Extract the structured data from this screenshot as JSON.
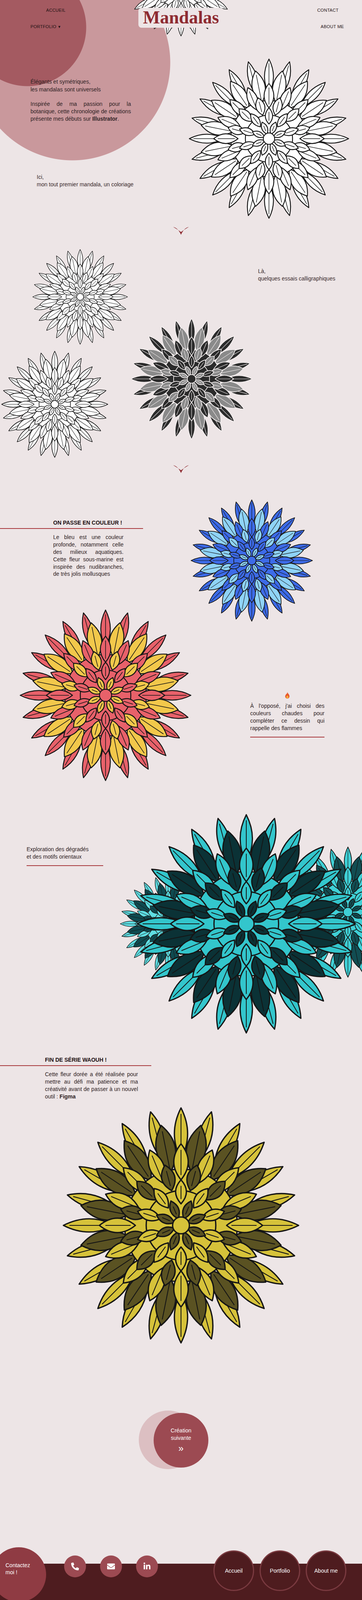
{
  "title": "Mandalas",
  "nav_left": [
    {
      "label": "ACCUEIL"
    },
    {
      "label": "PORTFOLIO",
      "caret": "▾"
    }
  ],
  "nav_right": [
    {
      "label": "CONTACT"
    },
    {
      "label": "ABOUT ME"
    }
  ],
  "intro": {
    "lead": [
      "Élégants et symétriques,",
      "les mandalas sont universels"
    ],
    "body": "Inspirée de ma passion pour la botanique, cette chronologie de créations présente mes débuts sur ",
    "strong": "Illustrator",
    "tail": "."
  },
  "first": {
    "caption": [
      "Ici,",
      "mon tout premier mandala, un coloriage"
    ],
    "art": {
      "colors": [
        "#ffffff"
      ]
    }
  },
  "calligraphy": {
    "caption": [
      "Là,",
      "quelques essais calligraphiques"
    ],
    "art": [
      {
        "colors": [
          "#ffffff"
        ]
      },
      {
        "colors": [
          "#2b2b2b"
        ]
      },
      {
        "colors": [
          "#ffffff"
        ]
      }
    ]
  },
  "blue": {
    "heading": "ON PASSE EN COULEUR !",
    "text": "Le bleu est une couleur profonde, notamment celle des milieux aquatiques. Cette fleur sous-marine est inspirée des nudibranches, de très jolis mollusques",
    "art": {
      "colors": [
        "#3d6be8",
        "#8fd3f7"
      ]
    }
  },
  "flame": {
    "text": "À l'opposé, j'ai choisi des couleurs chaudes pour compléter ce dessin qui rappelle des flammes",
    "art": {
      "colors": [
        "#e8616a",
        "#f2c84b"
      ]
    }
  },
  "gradient": {
    "text": [
      "Exploration des dégradés",
      "et des motifs orientaux"
    ],
    "art": [
      {
        "colors": [
          "#5fdde2",
          "#0f4a50"
        ]
      },
      {
        "colors": [
          "#3fd0d6",
          "#124d52"
        ]
      },
      {
        "colors": [
          "#33c6cc",
          "#0b3236"
        ]
      }
    ]
  },
  "finale": {
    "heading": "FIN DE SÉRIE WAOUH !",
    "body": "Cette fleur dorée a été réalisée pour mettre au défi ma patience et ma créativité avant de passer à un nouvel outil : ",
    "strong": "Figma",
    "art": {
      "colors": [
        "#d6c23a",
        "#5a5222"
      ]
    }
  },
  "next": {
    "label": "Création suivante",
    "icon": "»"
  },
  "footer": {
    "contact": "Contactez moi !",
    "nav": [
      "Accueil",
      "Portfolio",
      "About me"
    ]
  }
}
